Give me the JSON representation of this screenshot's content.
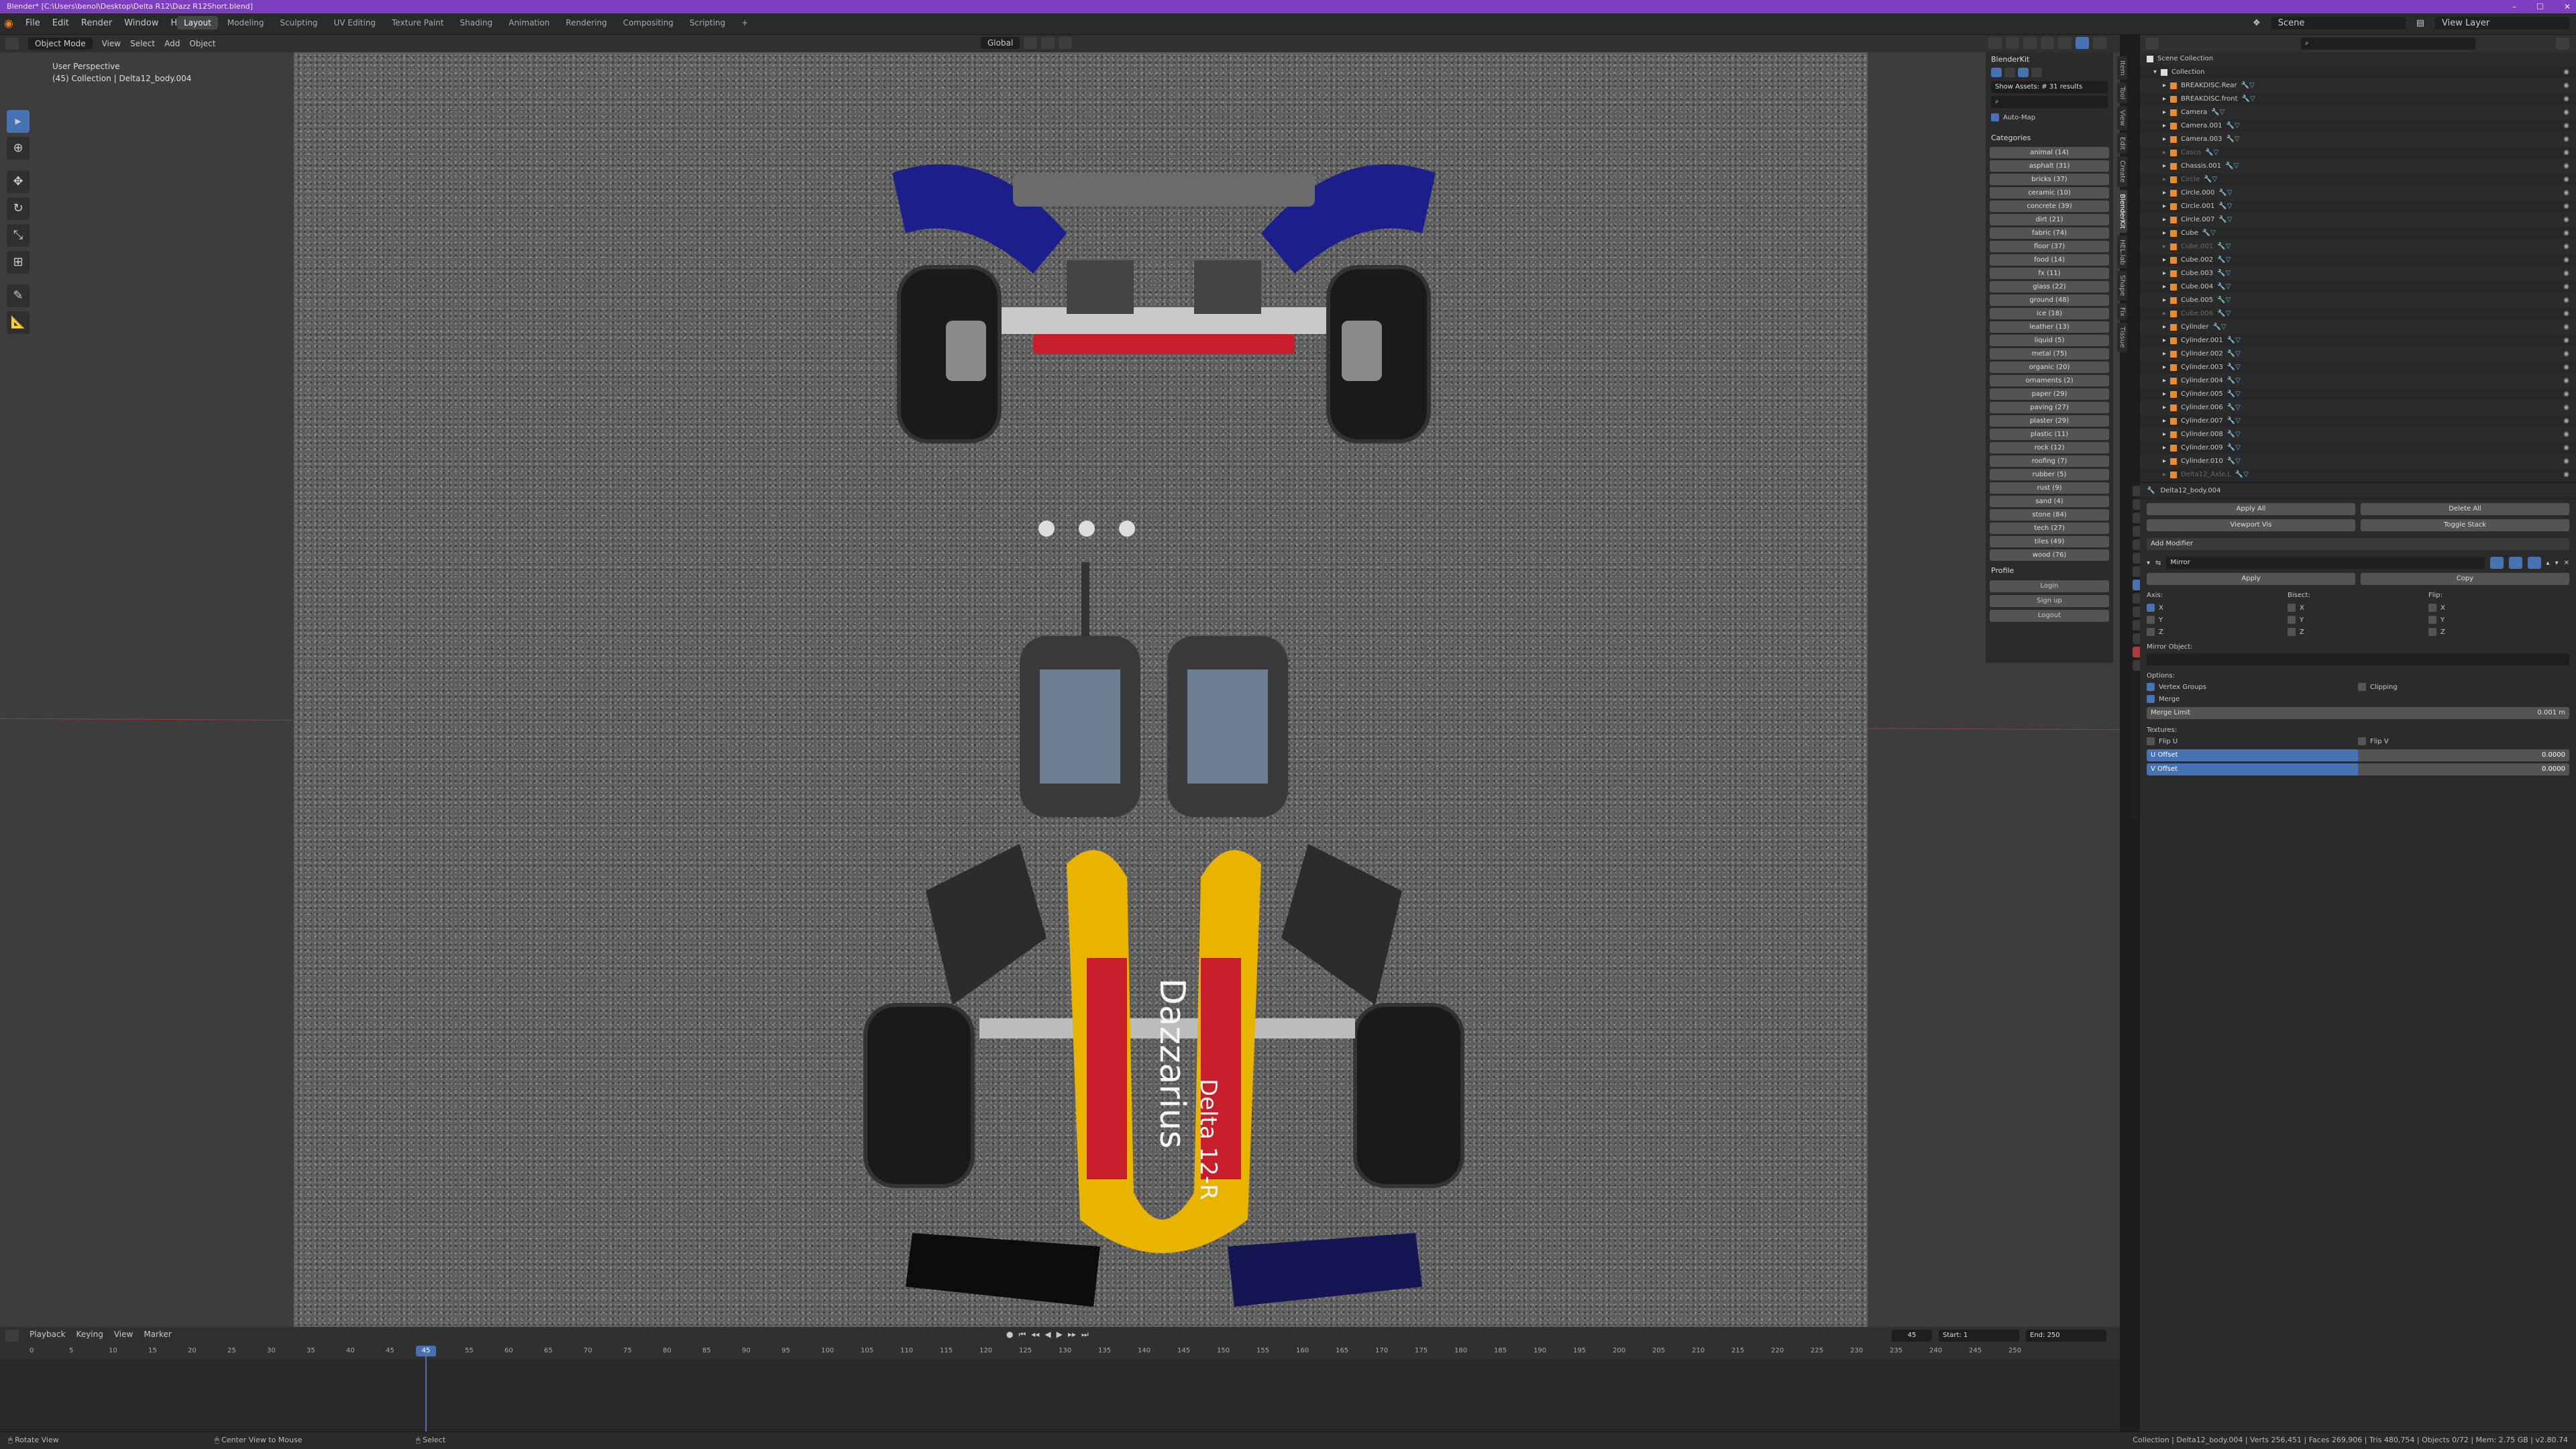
{
  "window": {
    "title": "Blender* [C:\\Users\\benol\\Desktop\\Delta R12\\Dazz R12Short.blend]"
  },
  "menu": [
    "File",
    "Edit",
    "Render",
    "Window",
    "Help"
  ],
  "workspaces": [
    "Layout",
    "Modeling",
    "Sculpting",
    "UV Editing",
    "Texture Paint",
    "Shading",
    "Animation",
    "Rendering",
    "Compositing",
    "Scripting"
  ],
  "active_workspace": "Layout",
  "scene": "Scene",
  "view_layer": "View Layer",
  "viewport": {
    "mode": "Object Mode",
    "menus": [
      "View",
      "Select",
      "Add",
      "Object"
    ],
    "orientation": "Global",
    "info_line1": "User Perspective",
    "info_line2": "(45) Collection | Delta12_body.004"
  },
  "side_tabs": [
    "Item",
    "Tool",
    "View",
    "Edit",
    "Create",
    "BlenderKit",
    "HEL.lab",
    "Shape",
    "Fix",
    "Tissue"
  ],
  "blenderkit": {
    "title": "BlenderKit",
    "show_assets": "Show Assets: # 31 results",
    "auto_map": "Auto-Map",
    "categories_title": "Categories",
    "categories": [
      "animal (14)",
      "asphalt (31)",
      "bricks (37)",
      "ceramic (10)",
      "concrete (39)",
      "dirt (21)",
      "fabric (74)",
      "floor (37)",
      "food (14)",
      "fx (11)",
      "glass (22)",
      "ground (48)",
      "ice (18)",
      "leather (13)",
      "liquid (5)",
      "metal (75)",
      "organic (20)",
      "ornaments (2)",
      "paper (29)",
      "paving (27)",
      "plaster (29)",
      "plastic (11)",
      "rock (12)",
      "roofing (7)",
      "rubber (5)",
      "rust (9)",
      "sand (4)",
      "stone (84)",
      "tech (27)",
      "tiles (49)",
      "wood (76)"
    ],
    "profile_title": "Profile",
    "profile_buttons": [
      "Login",
      "Sign up",
      "Logout"
    ]
  },
  "outliner": {
    "root": "Scene Collection",
    "collection": "Collection",
    "items": [
      {
        "name": "BREAKDISC.Rear",
        "dim": false
      },
      {
        "name": "BREAKDISC.front",
        "dim": false
      },
      {
        "name": "Camera",
        "dim": false
      },
      {
        "name": "Camera.001",
        "dim": false
      },
      {
        "name": "Camera.003",
        "dim": false
      },
      {
        "name": "Casco",
        "dim": true
      },
      {
        "name": "Chassis.001",
        "dim": false
      },
      {
        "name": "Circle",
        "dim": true
      },
      {
        "name": "Circle.000",
        "dim": false
      },
      {
        "name": "Circle.001",
        "dim": false
      },
      {
        "name": "Circle.007",
        "dim": false
      },
      {
        "name": "Cube",
        "dim": false
      },
      {
        "name": "Cube.001",
        "dim": true
      },
      {
        "name": "Cube.002",
        "dim": false
      },
      {
        "name": "Cube.003",
        "dim": false
      },
      {
        "name": "Cube.004",
        "dim": false
      },
      {
        "name": "Cube.005",
        "dim": false
      },
      {
        "name": "Cube.006",
        "dim": true
      },
      {
        "name": "Cylinder",
        "dim": false
      },
      {
        "name": "Cylinder.001",
        "dim": false
      },
      {
        "name": "Cylinder.002",
        "dim": false
      },
      {
        "name": "Cylinder.003",
        "dim": false
      },
      {
        "name": "Cylinder.004",
        "dim": false
      },
      {
        "name": "Cylinder.005",
        "dim": false
      },
      {
        "name": "Cylinder.006",
        "dim": false
      },
      {
        "name": "Cylinder.007",
        "dim": false
      },
      {
        "name": "Cylinder.008",
        "dim": false
      },
      {
        "name": "Cylinder.009",
        "dim": false
      },
      {
        "name": "Cylinder.010",
        "dim": false
      },
      {
        "name": "Delta12_Axle.L",
        "dim": true
      }
    ]
  },
  "properties": {
    "object": "Delta12_body.004",
    "apply_all": "Apply All",
    "delete_all": "Delete All",
    "viewport_vis": "Viewport Vis",
    "toggle_stack": "Toggle Stack",
    "add_modifier": "Add Modifier",
    "modifier_name": "Mirror",
    "apply": "Apply",
    "copy": "Copy",
    "axis_label": "Axis:",
    "bisect_label": "Bisect:",
    "flip_label": "Flip:",
    "axes": [
      "X",
      "Y",
      "Z"
    ],
    "mirror_object": "Mirror Object:",
    "options": "Options:",
    "vertex_groups": "Vertex Groups",
    "clipping": "Clipping",
    "merge": "Merge",
    "merge_limit": "Merge Limit",
    "merge_limit_val": "0.001 m",
    "textures": "Textures:",
    "flip_u": "Flip U",
    "flip_v": "Flip V",
    "u_offset": "U Offset",
    "v_offset": "V Offset",
    "u_val": "0.0000",
    "v_val": "0.0000"
  },
  "timeline": {
    "menus": [
      "Playback",
      "Keying",
      "View",
      "Marker"
    ],
    "current": "45",
    "frame_field": "45",
    "start_label": "Start:",
    "start": "1",
    "end_label": "End:",
    "end": "250",
    "ticks": [
      "0",
      "5",
      "10",
      "15",
      "20",
      "25",
      "30",
      "35",
      "40",
      "45",
      "50",
      "55",
      "60",
      "65",
      "70",
      "75",
      "80",
      "85",
      "90",
      "95",
      "100",
      "105",
      "110",
      "115",
      "120",
      "125",
      "130",
      "135",
      "140",
      "145",
      "150",
      "155",
      "160",
      "165",
      "170",
      "175",
      "180",
      "185",
      "190",
      "195",
      "200",
      "205",
      "210",
      "215",
      "220",
      "225",
      "230",
      "235",
      "240",
      "245",
      "250"
    ]
  },
  "status": {
    "left": "Rotate View",
    "mid": "Center View to Mouse",
    "select": "Select",
    "right": "Collection | Delta12_body.004 | Verts 256,451 | Faces 269,906 | Tris 480,754 | Objects 0/72 | Mem: 2.75 GB | v2.80.74"
  },
  "colors": {
    "titlebar": "#7b3fc0",
    "accent": "#4772b3",
    "car_yellow": "#e8b400",
    "car_blue": "#1c1f8a",
    "car_red": "#c81d2a"
  },
  "car_text": "Dazzarius Delta 12-R"
}
